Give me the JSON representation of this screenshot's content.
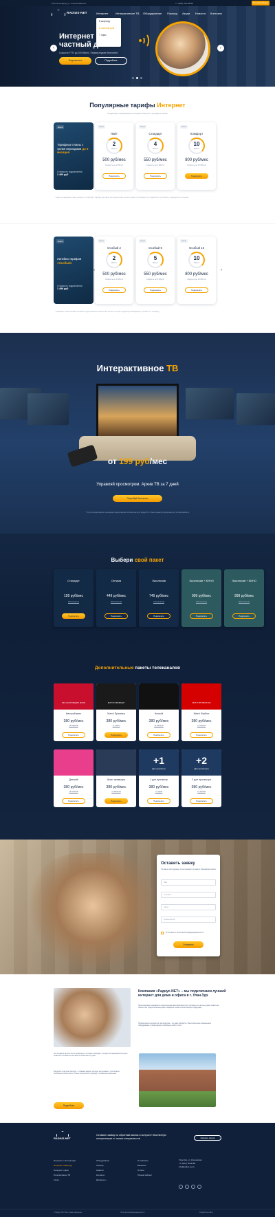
{
  "topbar": {
    "left": "Ростов-на-Дону, ул. Станиславского",
    "phone": "+7 (863) 310-88-88",
    "account": "Личный кабинет"
  },
  "nav": {
    "logo": "RADIUS-NET",
    "items": [
      "Интернет",
      "Интерактивное ТВ",
      "Оборудование",
      "Помощь",
      "Акции",
      "Новости",
      "Контакты"
    ],
    "dropdown": [
      "В квартиру",
      "В частный дом",
      "В офис"
    ]
  },
  "hero": {
    "title": "Интернет в частный дом",
    "subtitle": "Скорость FTTx до 100 Мбит/с. Первая неделя бесплатно!",
    "btn_primary": "Подключить",
    "btn_secondary": "Подробнее"
  },
  "tariffs1": {
    "title": "Популярные тарифы",
    "title_accent": "Интернет",
    "subtitle": "Подробную информацию об акциях смотрите в разделе Акции",
    "promo": {
      "badge": "акция",
      "text": "Тарифные планы с тремя периодами",
      "accent": "до 3 месяцев",
      "cost_label": "Стоимость подключения",
      "cost_value": "1 499 руб"
    },
    "cards": [
      {
        "badge": "акция",
        "name": "Лайт",
        "speed": "2",
        "unit": "Мбит/с",
        "price": "500 руб/мес",
        "note": "Скорость до 2 Мбит/с",
        "btn": "Подключить"
      },
      {
        "badge": "акция",
        "name": "Стандарт",
        "speed": "4",
        "unit": "Мбит/с",
        "price": "550 руб/мес",
        "note": "Скорость до 4 Мбит/с",
        "btn": "Подключить"
      },
      {
        "badge": "акция",
        "name": "Комфорт",
        "speed": "10",
        "unit": "Мбит/с",
        "price": "800 руб/мес",
        "note": "Скорость до 10 Мбит/с",
        "btn": "Подключить"
      }
    ],
    "fineprint": "* Цены на тарифные планы указаны с учетом НДС. Тарифы действуют при подключении частного дома к сети Радиус-Нет. Подробности уточняйте у операторов по телефону."
  },
  "tariffs2": {
    "promo": {
      "badge": "акция",
      "text": "Линейка тарифов",
      "accent": "«Особый»",
      "cost_label": "Стоимость подключения",
      "cost_value": "1 499 руб"
    },
    "cards": [
      {
        "badge": "акция",
        "name": "Особый 2",
        "speed": "2",
        "unit": "Мбит/с",
        "price": "500 руб/мес",
        "note": "Скорость до 2 Мбит/с",
        "btn": "Подключить"
      },
      {
        "badge": "акция",
        "name": "Особый 5",
        "speed": "5",
        "unit": "Мбит/с",
        "price": "550 руб/мес",
        "note": "Скорость до 5 Мбит/с",
        "btn": "Подключить"
      },
      {
        "badge": "акция",
        "name": "Особый 10",
        "speed": "10",
        "unit": "Мбит/с",
        "price": "800 руб/мес",
        "note": "Скорость до 10 Мбит/с",
        "btn": "Подключить"
      }
    ],
    "fineprint": "* Тарифные планы линейки «Особый» предоставляются абонентам частного сектора. Подробную информацию уточняйте по телефону."
  },
  "tv": {
    "title": "Интерактивное",
    "title_accent": "ТВ",
    "price_prefix": "от",
    "price_accent": "199 руб",
    "price_suffix": "/мес",
    "control": "Управляй просмотром. Архив ТВ за 7 дней",
    "btn": "Попробуй бесплатно",
    "fineprint": "* Услуга интерактивного телевидения предоставляется абонентам сети Радиус-Нет. Пакеты каналов подключаются в личном кабинете."
  },
  "packs": {
    "title": "Выбери",
    "title_accent": "свой пакет",
    "items": [
      {
        "name": "Стандарт",
        "price": "199 руб/мес",
        "channels": "150 каналов",
        "btn": "Подключить",
        "fill": true
      },
      {
        "name": "Оптима",
        "price": "449 руб/мес",
        "channels": "200 каналов",
        "btn": "Подключить",
        "fill": false
      },
      {
        "name": "Эксклюзив",
        "price": "749 руб/мес",
        "channels": "270 каналов",
        "btn": "Подключить",
        "fill": false
      },
      {
        "name": "Эксклюзив + КИНО",
        "price": "999 руб/мес",
        "channels": "300 каналов",
        "btn": "Подключить",
        "fill": false
      },
      {
        "name": "Эксклюзив + КИНО",
        "price": "999 руб/мес",
        "channels": "300 каналов",
        "btn": "Подключить",
        "fill": false
      }
    ]
  },
  "addons": {
    "title_accent": "Дополнительные",
    "title": "пакеты телеканалов",
    "items": [
      {
        "big": "",
        "cap": "333 НАСТОЯЩИХ КИНО",
        "name": "Настрой кино",
        "price": "380 руб/мес",
        "channels": "+5 каналов",
        "btn": "Подключить",
        "color": "#c8102e",
        "fill": false
      },
      {
        "big": "",
        "cap": "МАТЧ! ПРЕМЬЕР",
        "name": "Матч! Премьер",
        "price": "380 руб/мес",
        "channels": "+1 канал",
        "btn": "Подключить",
        "color": "#1a1a1a",
        "fill": true
      },
      {
        "big": "",
        "cap": "",
        "name": "Ночной",
        "price": "380 руб/мес",
        "channels": "+5 каналов",
        "btn": "Подключить",
        "color": "#111111",
        "fill": false
      },
      {
        "big": "",
        "cap": "МАТЧ! ФУТБОЛ HD",
        "name": "Матч! Футбол",
        "price": "380 руб/мес",
        "channels": "+3 канала",
        "btn": "Подключить",
        "color": "#d50000",
        "fill": false
      },
      {
        "big": "",
        "cap": "",
        "name": "Детский",
        "price": "380 руб/мес",
        "channels": "+5 каналов",
        "btn": "Подключить",
        "color": "#e83e8c",
        "fill": false
      },
      {
        "big": "",
        "cap": "",
        "name": "Шоит премьера",
        "price": "380 руб/мес",
        "channels": "+5 каналов",
        "btn": "Подключить",
        "color": "#2a3b57",
        "fill": true
      },
      {
        "big": "+1",
        "cap": "Доп просмотр",
        "name": "1 доп просмотр",
        "price": "380 руб/мес",
        "channels": "+1 экран",
        "btn": "Подключить",
        "color": "#1f3a60",
        "fill": false
      },
      {
        "big": "+2",
        "cap": "Доп просмотра",
        "name": "2 доп просмотра",
        "price": "380 руб/мес",
        "channels": "+2 экрана",
        "btn": "Подключить",
        "color": "#1f3a60",
        "fill": false
      }
    ]
  },
  "request": {
    "title": "Оставить заявку",
    "subtitle": "Оставьте свои данные и мы свяжемся с вами в ближайшее время",
    "fields": [
      "Имя",
      "Телефон",
      "Адрес",
      "Комментарий"
    ],
    "agree": "Я согласен с политикой конфиденциальности",
    "btn": "Отправить"
  },
  "about": {
    "title": "Компания «Радиус-NET» – мы подключаем лучший интернет для дома и офиса в г. Улан-Удэ",
    "p1": "Наша компания занимается подключением высокоскоростного интернета в частные дома, квартиры, офисы. Мы предлагаем выгодные тарифные планы и качественную поддержку.",
    "p2": "Подключение интернета в частный дом – это наш приоритет. Мы используем современное оборудование и гарантируем стабильную работу сети.",
    "p3": "Не так давно мы все были привязаны к сетевым проводам. Сегодня беспроводной интернет позволяет оставаться на связи в любом месте дома.",
    "p4": "Интернет в частном секторе – сложная задача, которую мы решаем с учетом всех особенностей местности. Наши специалисты подберут оптимальное решение.",
    "btn": "Подробнее"
  },
  "footer": {
    "logo": "RADIUS-NET",
    "text": "Оставьте заявку на обратный звонок и получите бесплатную консультацию от наших специалистов",
    "btn": "Заказать звонок",
    "col1": [
      "Интернет в частный дом",
      "Интернет в квартиру",
      "Интернет в офис",
      "Интерактивное ТВ",
      "Акции"
    ],
    "col2": [
      "Оборудование",
      "Помощь",
      "Новости",
      "Контакты",
      "Документы"
    ],
    "col3": [
      "О компании",
      "Вакансии",
      "Оплата",
      "Личный кабинет"
    ],
    "contacts": [
      "Улан-Удэ, ул. Ключевская",
      "+7 (3012) 55-88-88",
      "info@radius-net.ru"
    ],
    "copy": "© Радиус-NET. Все права защищены",
    "policy": "Политика конфиденциальности",
    "dev": "Разработка сайта"
  }
}
